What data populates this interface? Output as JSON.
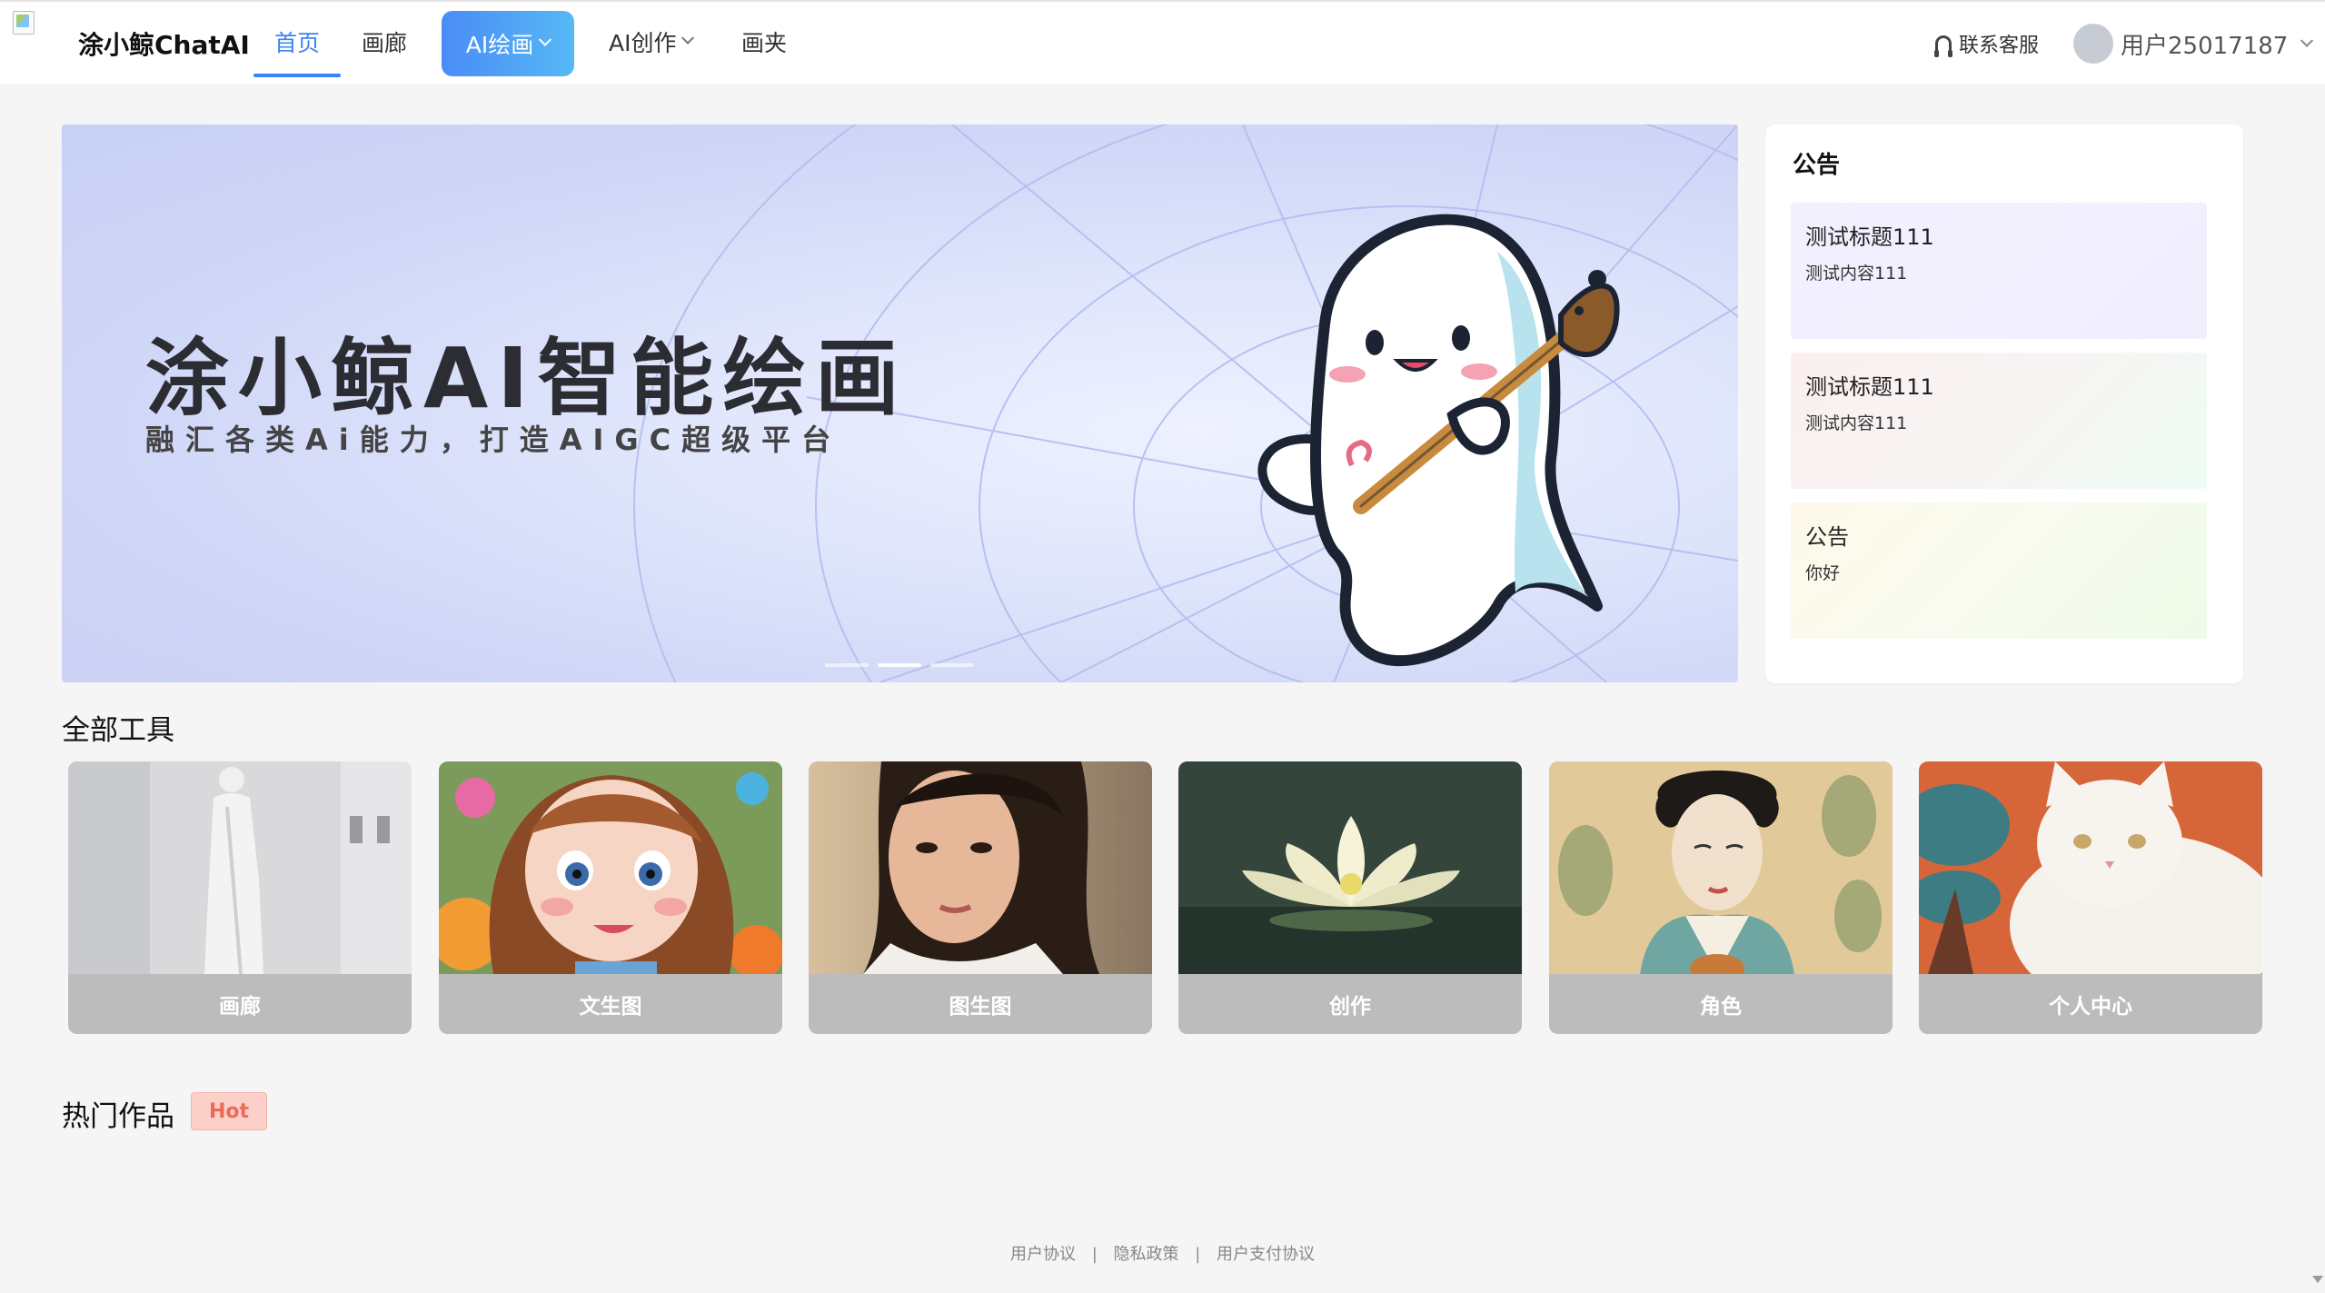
{
  "header": {
    "brand": "涂小鲸ChatAI",
    "nav": {
      "home": "首页",
      "gallery": "画廊",
      "ai_draw": "AI绘画",
      "ai_create": "AI创作",
      "folder": "画夹"
    },
    "support": "联系客服",
    "username": "用户25017187"
  },
  "banner": {
    "title": "涂小鲸AI智能绘画",
    "subtitle": "融汇各类Ai能力，打造AIGC超级平台",
    "dots": 3,
    "active_dot": 2
  },
  "notice": {
    "title": "公告",
    "items": [
      {
        "title": "测试标题111",
        "content": "测试内容111"
      },
      {
        "title": "测试标题111",
        "content": "测试内容111"
      },
      {
        "title": "公告",
        "content": "你好"
      }
    ]
  },
  "tools": {
    "title": "全部工具",
    "items": [
      {
        "label": "画廊",
        "icon": "statue-image"
      },
      {
        "label": "文生图",
        "icon": "cartoon-girl-image"
      },
      {
        "label": "图生图",
        "icon": "portrait-image"
      },
      {
        "label": "创作",
        "icon": "lotus-image"
      },
      {
        "label": "角色",
        "icon": "painting-lady-image"
      },
      {
        "label": "个人中心",
        "icon": "white-cat-image"
      }
    ]
  },
  "hot": {
    "title": "热门作品",
    "badge": "Hot"
  },
  "footer": {
    "links": [
      "用户协议",
      "隐私政策",
      "用户支付协议"
    ]
  },
  "colors": {
    "accent": "#3a82f6",
    "hot": "#ec6a55"
  }
}
